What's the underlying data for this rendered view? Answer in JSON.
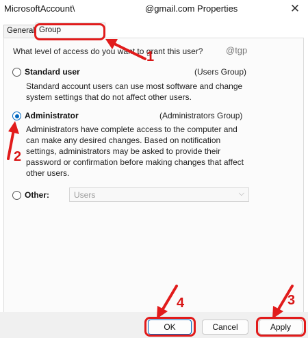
{
  "window": {
    "title_left": "MicrosoftAccount\\",
    "title_right": "@gmail.com Properties",
    "close_glyph": "✕"
  },
  "tabs": [
    {
      "label": "General",
      "selected": false
    },
    {
      "label": "Group Membership",
      "selected": true
    }
  ],
  "content": {
    "question": "What level of access do you want to grant this user?",
    "watermark": "@tgp",
    "options": [
      {
        "label": "Standard user",
        "group": "(Users Group)",
        "selected": false,
        "description": "Standard account users can use most software and change system settings that do not affect other users."
      },
      {
        "label": "Administrator",
        "group": "(Administrators Group)",
        "selected": true,
        "description": "Administrators have complete access to the computer and can make any desired changes. Based on notification settings, administrators may be asked to provide their password or confirmation before making changes that affect other users."
      },
      {
        "label": "Other:",
        "selected": false,
        "select_value": "Users",
        "select_chevron": "⌵"
      }
    ]
  },
  "buttons": {
    "ok": "OK",
    "cancel": "Cancel",
    "apply": "Apply"
  },
  "annotations": {
    "color": "#e11b1b",
    "steps": [
      "1",
      "2",
      "3",
      "4"
    ]
  }
}
